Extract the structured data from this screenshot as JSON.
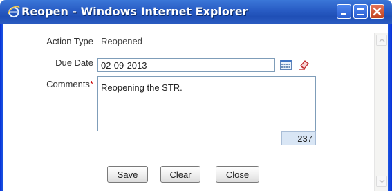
{
  "window": {
    "title": "Reopen - Windows Internet Explorer",
    "title_icon": "ie-icon",
    "controls": [
      "minimize-icon",
      "maximize-icon",
      "close-icon"
    ]
  },
  "form": {
    "action_type": {
      "label": "Action Type",
      "value": "Reopened"
    },
    "due_date": {
      "label": "Due Date",
      "value": "02-09-2013",
      "icons": [
        "calendar-icon",
        "clear-date-icon"
      ]
    },
    "comments": {
      "label": "Comments",
      "required_marker": "*",
      "value": "Reopening the STR.",
      "remaining_chars": "237"
    }
  },
  "buttons": {
    "save": "Save",
    "clear": "Clear",
    "close": "Close"
  },
  "colors": {
    "title_bar": "#2a5ec6",
    "close_button": "#c0421f",
    "count_box": "#d9e6f5",
    "required": "#cc0000"
  }
}
